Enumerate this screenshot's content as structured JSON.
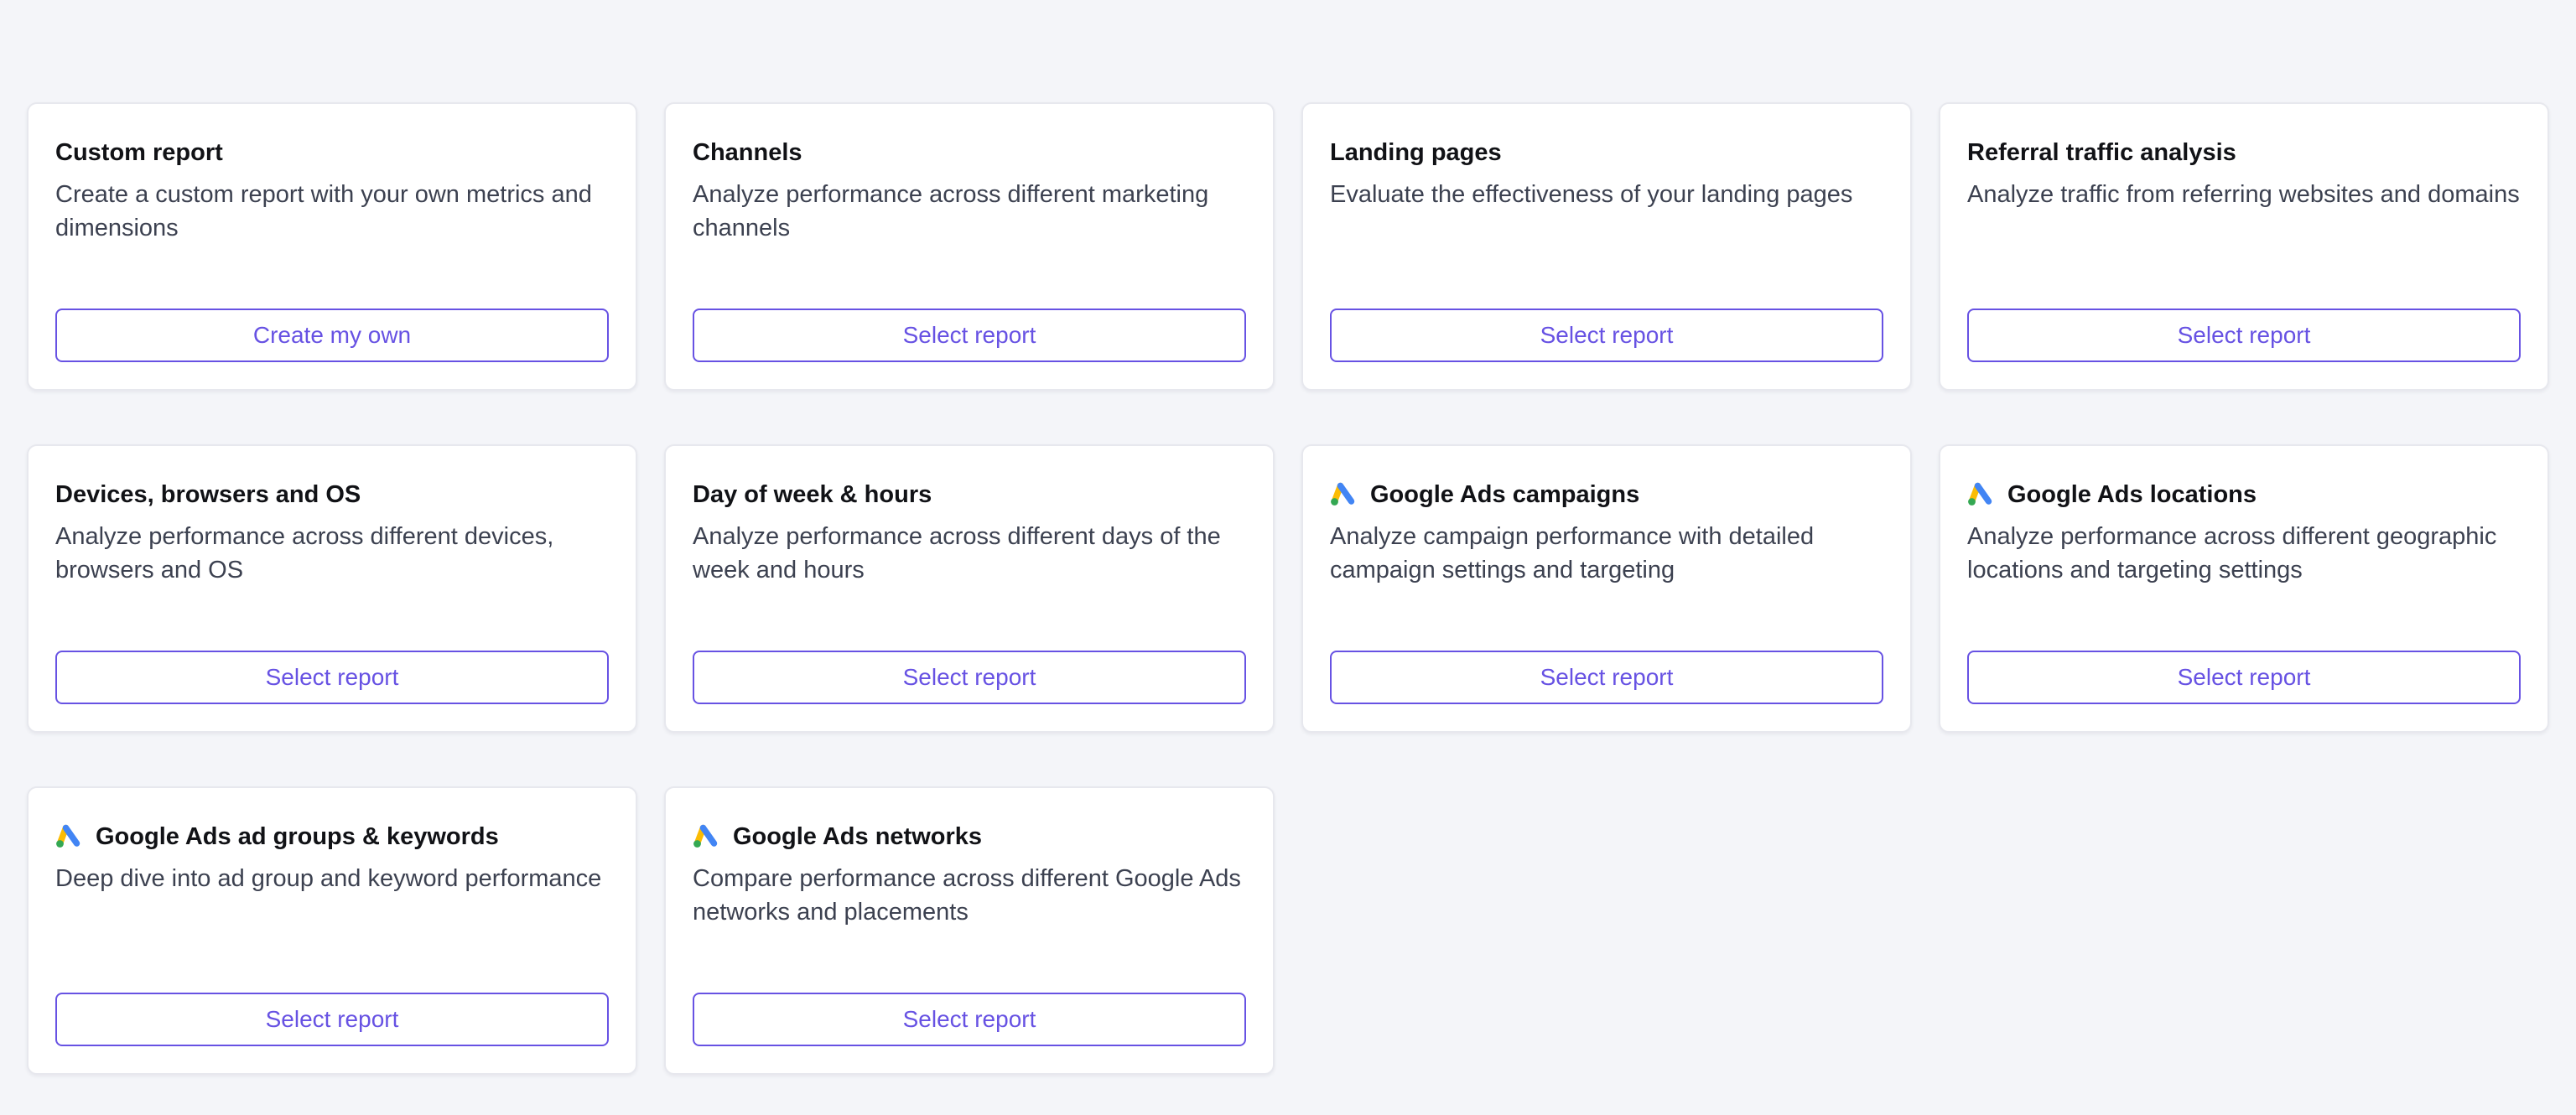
{
  "cards": [
    {
      "title": "Custom report",
      "description": "Create a custom report with your own metrics and dimensions",
      "button": "Create my own",
      "icon": null
    },
    {
      "title": "Channels",
      "description": "Analyze performance across different marketing channels",
      "button": "Select report",
      "icon": null
    },
    {
      "title": "Landing pages",
      "description": "Evaluate the effectiveness of your landing pages",
      "button": "Select report",
      "icon": null
    },
    {
      "title": "Referral traffic analysis",
      "description": "Analyze traffic from referring websites and domains",
      "button": "Select report",
      "icon": null
    },
    {
      "title": "Devices, browsers and OS",
      "description": "Analyze performance across different devices, browsers and OS",
      "button": "Select report",
      "icon": null
    },
    {
      "title": "Day of week & hours",
      "description": "Analyze performance across different days of the week and hours",
      "button": "Select report",
      "icon": null
    },
    {
      "title": "Google Ads campaigns",
      "description": "Analyze campaign performance with detailed campaign settings and targeting",
      "button": "Select report",
      "icon": "google-ads-icon"
    },
    {
      "title": "Google Ads locations",
      "description": "Analyze performance across different geographic locations and targeting settings",
      "button": "Select report",
      "icon": "google-ads-icon"
    },
    {
      "title": "Google Ads ad groups & keywords",
      "description": "Deep dive into ad group and keyword performance",
      "button": "Select report",
      "icon": "google-ads-icon"
    },
    {
      "title": "Google Ads networks",
      "description": "Compare performance across different Google Ads networks and placements",
      "button": "Select report",
      "icon": "google-ads-icon"
    }
  ],
  "colors": {
    "accent": "#6752e3",
    "background": "#f4f5f9",
    "card": "#ffffff",
    "title": "#111216",
    "text": "#3c4150",
    "google_blue": "#4285f4",
    "google_yellow": "#fbbc04",
    "google_green": "#34a853"
  }
}
